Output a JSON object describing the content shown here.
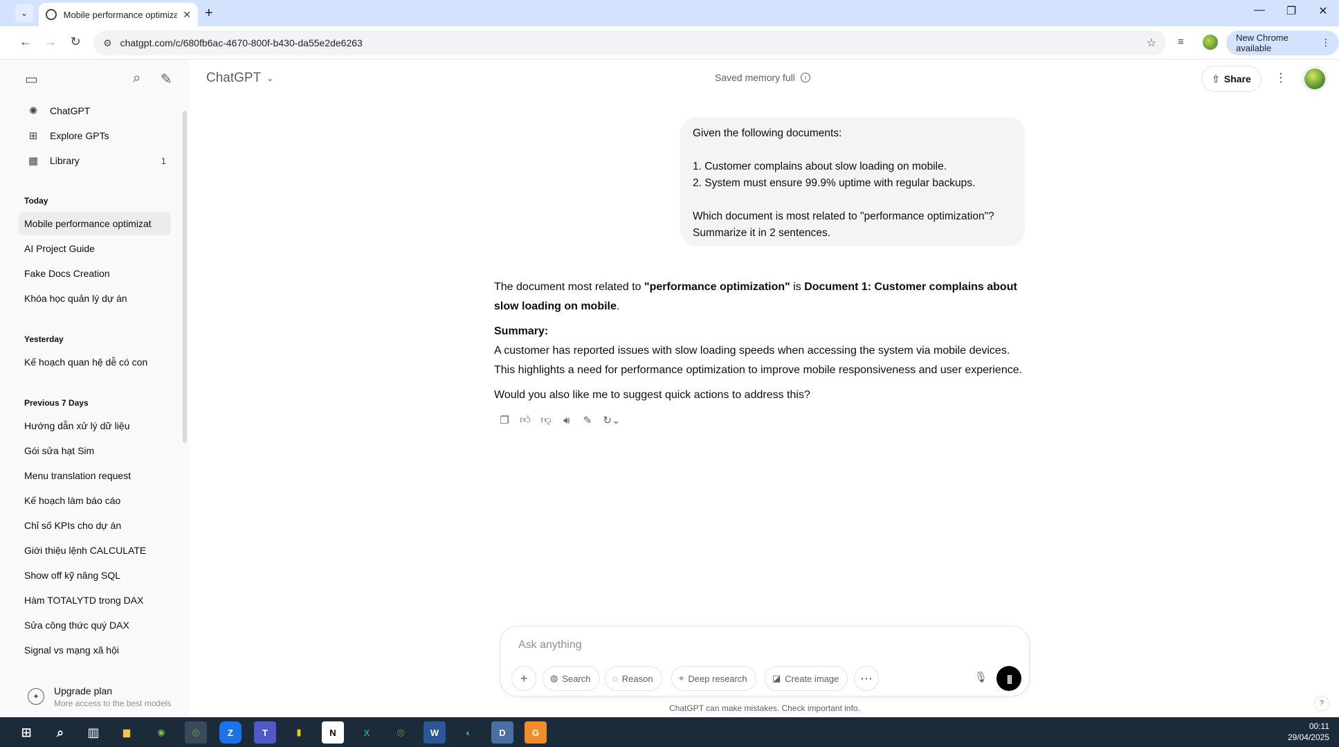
{
  "browser": {
    "tab_title": "Mobile performance optimizati",
    "url": "chatgpt.com/c/680fb6ac-4670-800f-b430-da55e2de6263",
    "update_label": "New Chrome available"
  },
  "sidebar": {
    "nav": [
      {
        "label": "ChatGPT",
        "icon": "openai-logo-icon"
      },
      {
        "label": "Explore GPTs",
        "icon": "grid-icon"
      },
      {
        "label": "Library",
        "icon": "library-icon",
        "count": "1"
      }
    ],
    "sections": [
      {
        "title": "Today",
        "items": [
          "Mobile performance optimizat",
          "AI Project Guide",
          "Fake Docs Creation",
          "Khóa học quản lý dự án"
        ]
      },
      {
        "title": "Yesterday",
        "items": [
          "Kế hoạch quan hệ dễ có con"
        ]
      },
      {
        "title": "Previous 7 Days",
        "items": [
          "Hướng dẫn xử lý dữ liệu",
          "Gói sửa hạt Sim",
          "Menu translation request",
          "Kế hoạch làm báo cáo",
          "Chỉ số KPIs cho dự án",
          "Giới thiệu lệnh CALCULATE",
          "Show off kỹ năng SQL",
          "Hàm TOTALYTD trong DAX",
          "Sửa công thức quý DAX",
          "Signal vs mạng xã hội"
        ]
      }
    ],
    "upgrade": {
      "title": "Upgrade plan",
      "subtitle": "More access to the best models"
    }
  },
  "header": {
    "model": "ChatGPT",
    "memory": "Saved memory full",
    "share": "Share"
  },
  "conversation": {
    "user_message": "Given the following documents:\n\n1. Customer complains about slow loading on mobile.\n2. System must ensure 99.9% uptime with regular backups.\n\nWhich document is most related to \"performance optimization\"? Summarize it in 2 sentences.",
    "assistant": {
      "p1_a": "The document most related to ",
      "p1_b": "\"performance optimization\"",
      "p1_c": " is ",
      "p1_d": "Document 1: Customer complains about slow loading on mobile",
      "p1_e": ".",
      "summary_label": "Summary:",
      "summary_text": "A customer has reported issues with slow loading speeds when accessing the system via mobile devices. This highlights a need for performance optimization to improve mobile responsiveness and user experience.",
      "followup": "Would you also like me to suggest quick actions to address this?"
    }
  },
  "composer": {
    "placeholder": "Ask anything",
    "tools": [
      "Search",
      "Reason",
      "Deep research",
      "Create image"
    ],
    "disclaimer": "ChatGPT can make mistakes. Check important info."
  },
  "taskbar": {
    "time": "00:11",
    "date": "29/04/2025"
  },
  "colors": {
    "tabstrip": "#d3e3fd",
    "sidebar": "#f9f9f9",
    "user_bubble": "#f4f4f4",
    "taskbar": "#1c2b3a"
  }
}
